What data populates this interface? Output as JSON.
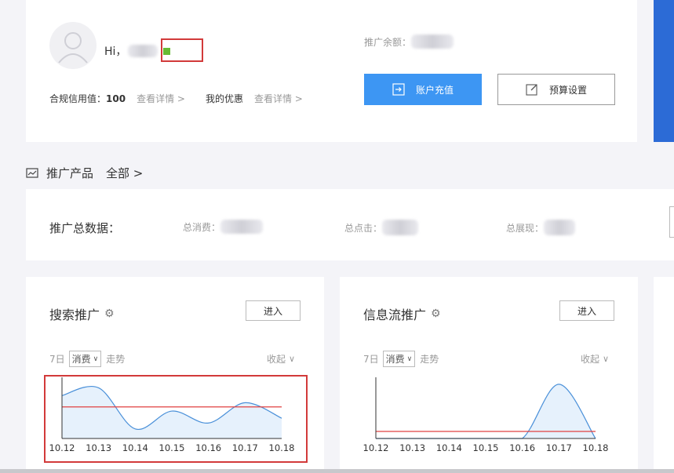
{
  "account": {
    "greeting": "Hi，",
    "credit_label": "合规信用值：",
    "credit_value": "100",
    "credit_detail_link": "查看详情 >",
    "offers_label": "我的优惠",
    "offers_detail_link": "查看详情 >",
    "balance_label": "推广余额：",
    "recharge_button": "账户充值",
    "budget_button": "预算设置",
    "status_color": "#66bb33"
  },
  "products_header": {
    "title": "推广产品",
    "all_link": "全部 >"
  },
  "totals": {
    "title": "推广总数据：",
    "spend_label": "总消费：",
    "clicks_label": "总点击：",
    "impressions_label": "总展现："
  },
  "cards": [
    {
      "title": "搜索推广",
      "enter_button": "进入",
      "period": "7日",
      "metric_selected": "消费",
      "trend_label": "走势",
      "collapse_label": "收起"
    },
    {
      "title": "信息流推广",
      "enter_button": "进入",
      "period": "7日",
      "metric_selected": "消费",
      "trend_label": "走势",
      "collapse_label": "收起"
    }
  ],
  "chart_data": [
    {
      "type": "area",
      "categories": [
        "10.12",
        "10.13",
        "10.14",
        "10.15",
        "10.16",
        "10.17",
        "10.18"
      ],
      "series": [
        {
          "values": [
            0.72,
            0.85,
            0.16,
            0.46,
            0.26,
            0.6,
            0.34
          ]
        }
      ],
      "reference_line": 0.53,
      "ylim": [
        0,
        1
      ],
      "fill_color": "#e6f1fc",
      "line_color": "#4a90d9",
      "reference_color": "#e04040"
    },
    {
      "type": "area",
      "categories": [
        "10.12",
        "10.13",
        "10.14",
        "10.15",
        "10.16",
        "10.17",
        "10.18"
      ],
      "series": [
        {
          "values": [
            0,
            0,
            0,
            0,
            0,
            1.0,
            0
          ]
        }
      ],
      "reference_line": 0.13,
      "ylim": [
        0,
        1.1
      ],
      "fill_color": "#e6f1fc",
      "line_color": "#4a90d9",
      "reference_color": "#e04040"
    }
  ]
}
